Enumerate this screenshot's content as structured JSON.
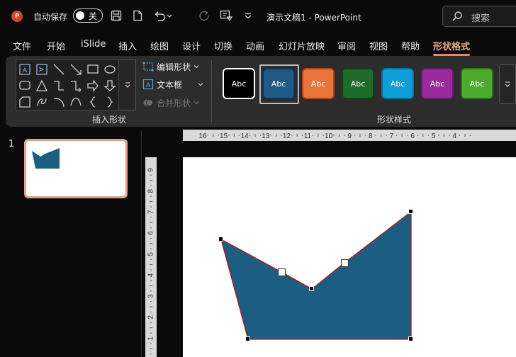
{
  "titlebar": {
    "app_icon": "powerpoint-logo-icon",
    "app_icon_letter": "P",
    "autosave_label": "自动保存",
    "autosave_state": "关",
    "document_title": "演示文稿1  -  PowerPoint",
    "search_placeholder": "搜索",
    "qat_icons": [
      "save-icon",
      "new-file-icon",
      "undo-icon",
      "redo-icon",
      "present-icon",
      "customize-qat-icon"
    ]
  },
  "tabs": [
    {
      "label": "文件",
      "active": false
    },
    {
      "label": "开始",
      "active": false
    },
    {
      "label": "iSlide",
      "active": false
    },
    {
      "label": "插入",
      "active": false
    },
    {
      "label": "绘图",
      "active": false
    },
    {
      "label": "设计",
      "active": false
    },
    {
      "label": "切换",
      "active": false
    },
    {
      "label": "动画",
      "active": false
    },
    {
      "label": "幻灯片放映",
      "active": false
    },
    {
      "label": "审阅",
      "active": false
    },
    {
      "label": "视图",
      "active": false
    },
    {
      "label": "帮助",
      "active": false
    },
    {
      "label": "形状格式",
      "active": true
    }
  ],
  "ribbon": {
    "insert_shapes_label": "插入形状",
    "edit_shape_label": "编辑形状",
    "textbox_label": "文本框",
    "merge_shapes_label": "合并形状",
    "shape_styles_label": "形状样式",
    "style_preview_text": "Abc",
    "shape_styles": [
      {
        "fill": "#000000",
        "border": "#ffffff"
      },
      {
        "fill": "#1f5b85",
        "border": "#0f3550"
      },
      {
        "fill": "#e8743b",
        "border": "#a9481a"
      },
      {
        "fill": "#1e6b2a",
        "border": "#0f4418"
      },
      {
        "fill": "#0e9fd8",
        "border": "#0a6e96"
      },
      {
        "fill": "#9b2a9e",
        "border": "#6a1a6c"
      },
      {
        "fill": "#4caa2c",
        "border": "#2e7417"
      }
    ],
    "selected_style_index": 1
  },
  "thumbnails": {
    "slide_number": "1"
  },
  "rulers": {
    "horizontal_labels": [
      "16",
      "15",
      "14",
      "13",
      "12",
      "11",
      "10",
      "9",
      "8",
      "7",
      "6",
      "5",
      "4"
    ],
    "vertical_labels": [
      "9",
      "8",
      "7",
      "6",
      "5",
      "4",
      "3",
      "2",
      "1"
    ]
  },
  "canvas": {
    "shape_fill": "#1b5e82",
    "shape_outline": "#b01515",
    "handle_color": "#000000"
  }
}
